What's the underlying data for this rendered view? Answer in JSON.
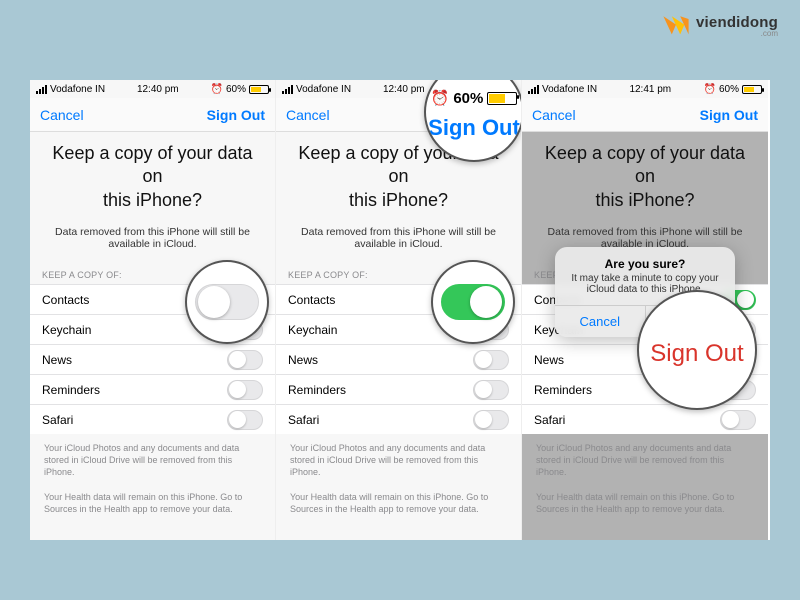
{
  "watermark": {
    "brand": "viendidong",
    "sub": ".com"
  },
  "common": {
    "carrier": "Vodafone IN",
    "battery_pct": "60%",
    "title_line1": "Keep a copy of your data on",
    "title_line2": "this iPhone?",
    "subhead": "Data removed from this iPhone will still be available in iCloud.",
    "section_label": "KEEP A COPY OF:",
    "nav_cancel": "Cancel",
    "nav_signout": "Sign Out",
    "foot1": "Your iCloud Photos and any documents and data stored in iCloud Drive will be removed from this iPhone.",
    "foot2": "Your Health data will remain on this iPhone. Go to Sources in the Health app to remove your data.",
    "rows": {
      "contacts": "Contacts",
      "keychain": "Keychain",
      "news": "News",
      "reminders": "Reminders",
      "safari": "Safari"
    }
  },
  "screen1": {
    "time": "12:40 pm",
    "contacts_on": false
  },
  "screen2": {
    "time": "12:40 pm",
    "contacts_on": true,
    "lens_batt": "60%",
    "lens_label": "Sign Out"
  },
  "screen3": {
    "time": "12:41 pm",
    "alert_title": "Are you sure?",
    "alert_msg": "It may take a minute to copy your iCloud data to this iPhone.",
    "alert_cancel": "Cancel",
    "alert_signout": "Sign Out",
    "lens_label": "Sign Out"
  }
}
